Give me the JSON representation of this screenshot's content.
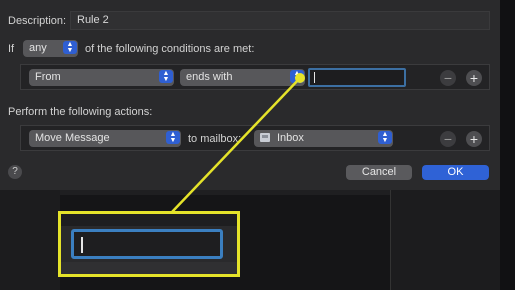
{
  "description": {
    "label": "Description:",
    "value": "Rule 2"
  },
  "condition_header": {
    "if_label": "If",
    "quantifier": "any",
    "suffix": "of the following conditions are met:"
  },
  "condition_row": {
    "field": "From",
    "operator": "ends with",
    "value": "",
    "remove_icon": "minus-icon",
    "add_icon": "plus-icon"
  },
  "actions_header": "Perform the following actions:",
  "action_row": {
    "action": "Move Message",
    "connector": "to mailbox:",
    "mailbox": "Inbox",
    "mailbox_icon": "mailbox-tray-icon",
    "remove_icon": "minus-icon",
    "add_icon": "plus-icon"
  },
  "help": "?",
  "buttons": {
    "cancel": "Cancel",
    "ok": "OK"
  },
  "colors": {
    "accent": "#2f62d6",
    "focus_ring": "#3c6fa2",
    "highlight": "#e5e32a"
  }
}
